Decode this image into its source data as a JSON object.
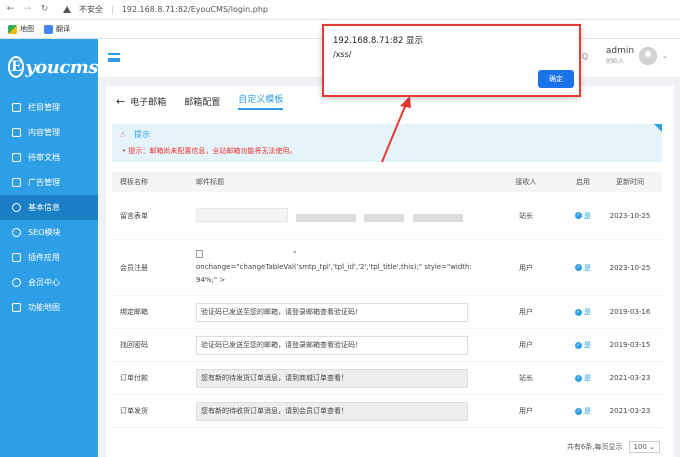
{
  "browser": {
    "insecure_label": "不安全",
    "url": "192.168.8.71:82/EyouCMS/login.php",
    "bookmarks": [
      "地图",
      "翻译"
    ]
  },
  "sidebar": {
    "logo": "youcms",
    "logo_letter": "E",
    "items": [
      {
        "label": "栏目管理",
        "icon": "layers-icon"
      },
      {
        "label": "内容管理",
        "icon": "document-icon"
      },
      {
        "label": "待审文档",
        "icon": "review-icon"
      },
      {
        "label": "广告管理",
        "icon": "ad-icon"
      },
      {
        "label": "基本信息",
        "icon": "gear-icon",
        "active": true
      },
      {
        "label": "SEO模块",
        "icon": "seo-icon"
      },
      {
        "label": "插件应用",
        "icon": "plugin-icon"
      },
      {
        "label": "会员中心",
        "icon": "user-icon"
      },
      {
        "label": "功能地图",
        "icon": "grid-icon"
      }
    ]
  },
  "topbar": {
    "user_name": "admin",
    "user_role": "创始人",
    "help_glyph": "Q"
  },
  "tabs": {
    "back_label": "电子邮箱",
    "items": [
      "邮箱配置",
      "自定义模板"
    ],
    "active": "自定义模板"
  },
  "tip": {
    "title": "提示",
    "message": "• 提示：邮箱尚未配置信息，全站邮箱功能将无法使用。"
  },
  "table": {
    "headers": [
      "模板名称",
      "邮件标题",
      "接收人",
      "启用",
      "更新时间"
    ],
    "enabled_label": "是",
    "rows": [
      {
        "name": "留言表单",
        "subject": "",
        "recipient": "站长",
        "time": "2023-10-25"
      },
      {
        "name": "会员注册",
        "subject": "\" onchange=\"changeTableVal('smtp_tpl','tpl_id','2','tpl_title',this);\" style=\"width: 94%;\" >",
        "recipient": "用户",
        "time": "2023-10-25"
      },
      {
        "name": "绑定邮箱",
        "subject": "验证码已发送至您的邮箱，请登录邮箱查看验证码！",
        "recipient": "用户",
        "time": "2019-03-16"
      },
      {
        "name": "找回密码",
        "subject": "验证码已发送至您的邮箱，请登录邮箱查看验证码！",
        "recipient": "用户",
        "time": "2019-03-15"
      },
      {
        "name": "订单付款",
        "subject": "您有新的待发货订单消息，请到商城订单查看！",
        "recipient": "站长",
        "time": "2021-03-23"
      },
      {
        "name": "订单发货",
        "subject": "您有新的待收货订单消息，请到会员订单查看！",
        "recipient": "用户",
        "time": "2021-03-23"
      }
    ]
  },
  "pager": {
    "summary": "共有6条,每页显示",
    "page_size": "100"
  },
  "alert": {
    "title": "192.168.8.71:82 显示",
    "message": "/xss/",
    "ok_label": "确定"
  },
  "colors": {
    "sidebar": "#2e9fe6",
    "sidebar_active": "#1a7fc4",
    "alert_border": "#e53935",
    "arrow": "#e53935",
    "ok_button": "#1a73e8"
  }
}
